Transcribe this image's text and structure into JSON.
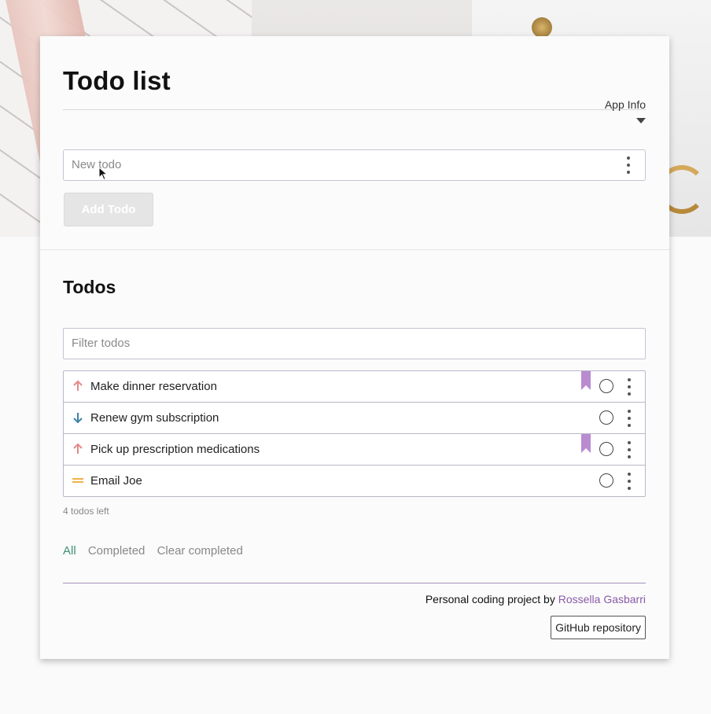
{
  "app": {
    "title": "Todo list",
    "app_info_label": "App Info"
  },
  "new_todo": {
    "placeholder": "New todo",
    "add_button_label": "Add Todo"
  },
  "todos_section": {
    "heading": "Todos",
    "filter_placeholder": "Filter todos"
  },
  "todos": [
    {
      "label": "Make dinner reservation",
      "priority": "high",
      "priority_icon": "arrow-up-icon",
      "bookmarked": true,
      "completed": false
    },
    {
      "label": "Renew gym subscription",
      "priority": "low",
      "priority_icon": "arrow-down-icon",
      "bookmarked": false,
      "completed": false
    },
    {
      "label": "Pick up prescription medications",
      "priority": "high",
      "priority_icon": "arrow-up-icon",
      "bookmarked": true,
      "completed": false
    },
    {
      "label": "Email Joe",
      "priority": "medium",
      "priority_icon": "equals-icon",
      "bookmarked": false,
      "completed": false
    }
  ],
  "status": {
    "todos_left": "4 todos left"
  },
  "filters": {
    "all": "All",
    "completed": "Completed",
    "clear_completed": "Clear completed",
    "active": "all"
  },
  "footer": {
    "credit_prefix": "Personal coding project by",
    "author": "Rossella Gasbarri",
    "github_button": "GitHub repository"
  },
  "colors": {
    "priority_high": "#e38a8a",
    "priority_low": "#3d84a8",
    "priority_medium": "#f0b24a",
    "bookmark": "#b98bd0",
    "accent_green": "#3f8f76",
    "author_link": "#8a5ba8"
  }
}
